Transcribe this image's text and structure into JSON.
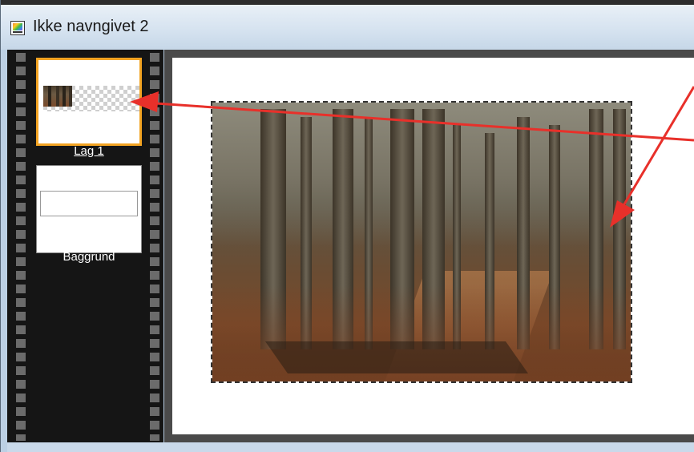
{
  "window": {
    "title": "Ikke navngivet 2",
    "icon": "image-editor-icon"
  },
  "layers": [
    {
      "name": "Lag 1",
      "selected": true,
      "thumbnail": "photo-on-transparent"
    },
    {
      "name": "Baggrund",
      "selected": false,
      "thumbnail": "white"
    }
  ],
  "canvas": {
    "image": "forest-photo",
    "selection": "dashed-marquee"
  },
  "annotations": {
    "arrow_color": "#e8302a"
  },
  "colors": {
    "selected_layer_border": "#f2a322",
    "filmstrip_bg": "#151515",
    "canvas_bg": "#ffffff"
  }
}
